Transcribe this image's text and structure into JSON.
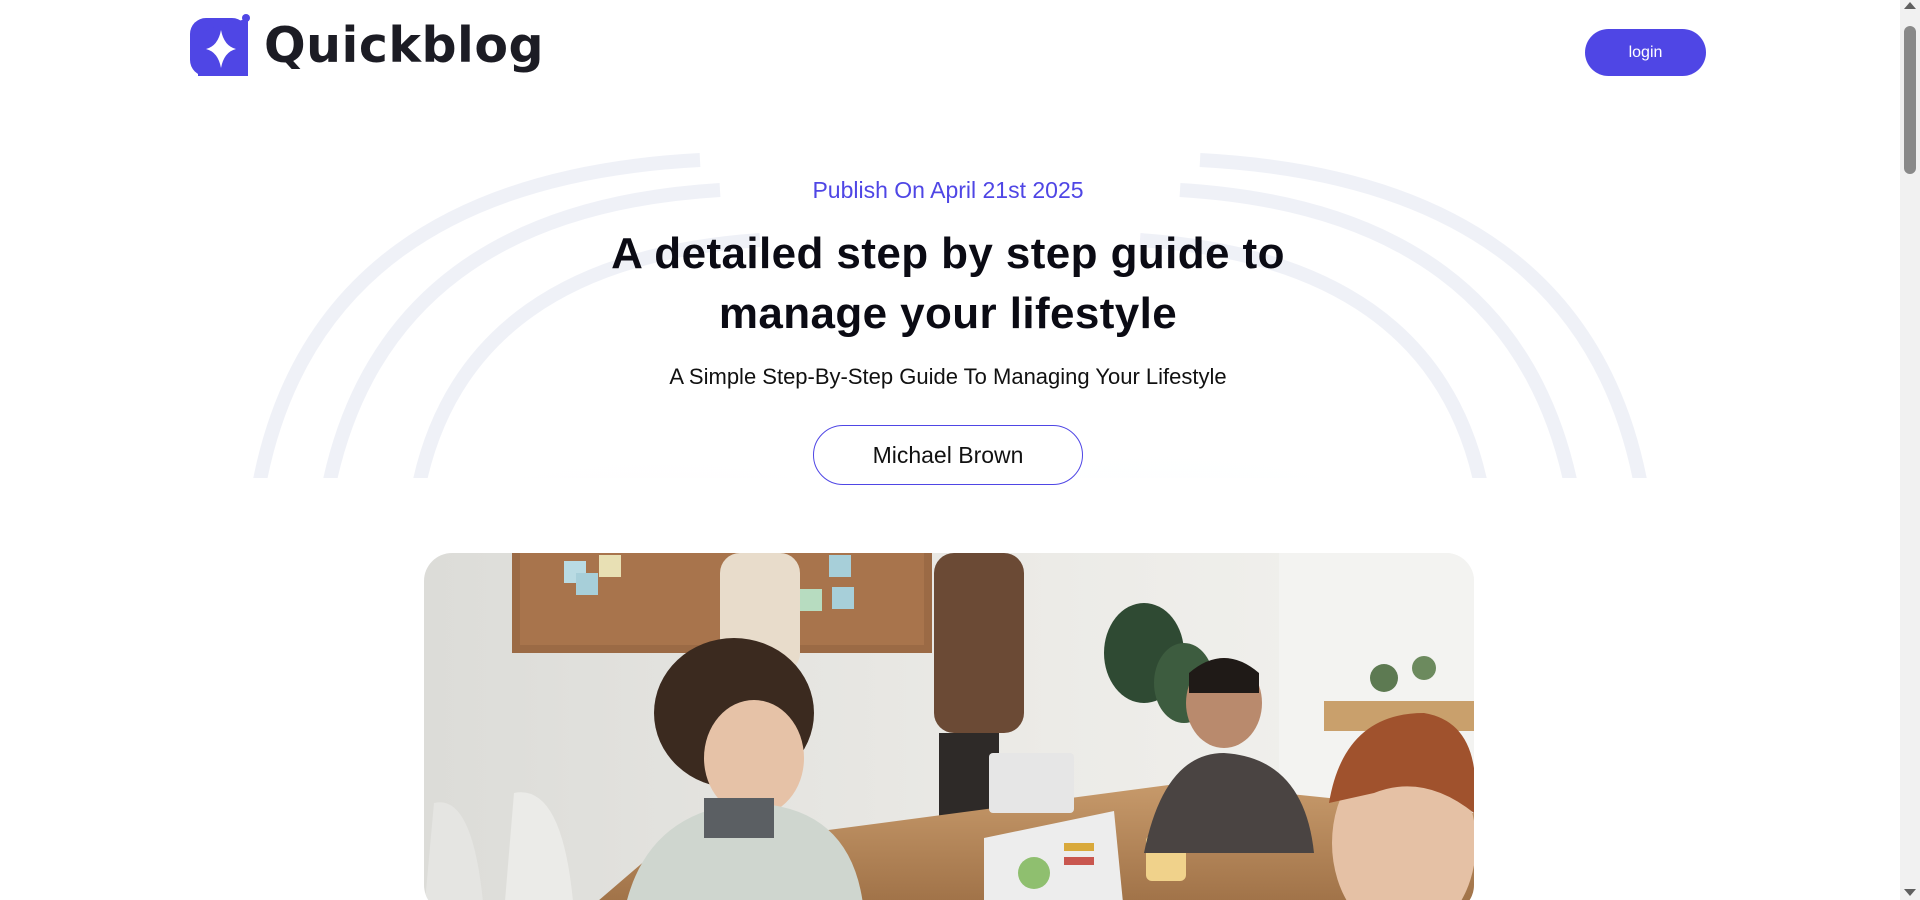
{
  "header": {
    "brand": "Quickblog",
    "login_label": "login"
  },
  "hero": {
    "publish_text": "Publish On April 21st 2025",
    "title": "A detailed step by step guide to manage your lifestyle",
    "subtitle": "A Simple Step-By-Step Guide To Managing Your Lifestyle",
    "author": "Michael Brown"
  },
  "colors": {
    "accent": "#4f46e5",
    "text": "#0b0b14",
    "background": "#ffffff"
  },
  "icons": {
    "logo": "sparkle-logo-icon"
  }
}
